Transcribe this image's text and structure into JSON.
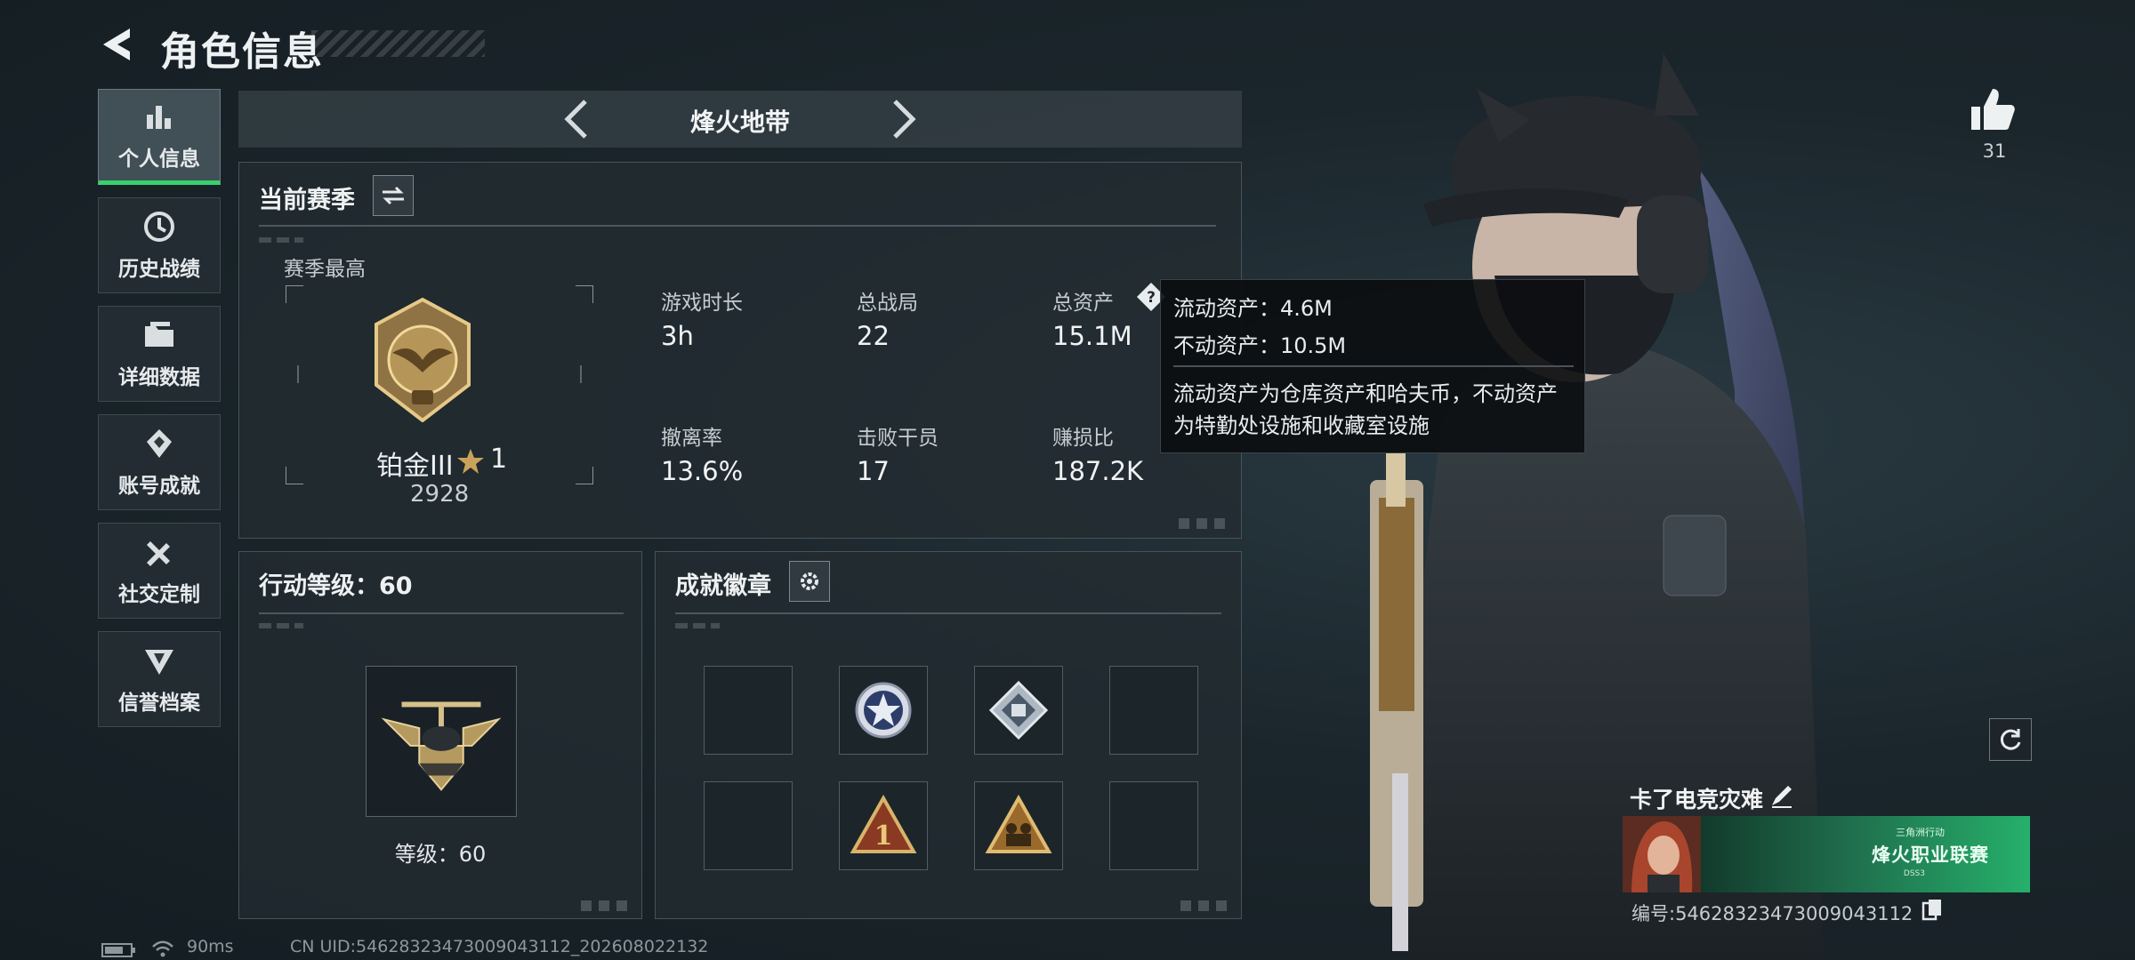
{
  "header": {
    "title": "角色信息"
  },
  "sidebar": {
    "items": [
      {
        "label": "个人信息",
        "active": true,
        "icon": "bar-chart-icon"
      },
      {
        "label": "历史战绩",
        "active": false,
        "icon": "clock-history-icon"
      },
      {
        "label": "详细数据",
        "active": false,
        "icon": "folder-icon"
      },
      {
        "label": "账号成就",
        "active": false,
        "icon": "achievement-icon"
      },
      {
        "label": "社交定制",
        "active": false,
        "icon": "tools-icon"
      },
      {
        "label": "信誉档案",
        "active": false,
        "icon": "shield-emblem-icon"
      }
    ]
  },
  "mode_nav": {
    "title": "烽火地带"
  },
  "season": {
    "title": "当前赛季",
    "best_label": "赛季最高",
    "rank": {
      "name": "铂金III",
      "stars": "1",
      "score": "2928"
    },
    "stats": [
      {
        "label": "游戏时长",
        "value": "3h"
      },
      {
        "label": "总战局",
        "value": "22"
      },
      {
        "label": "总资产",
        "value": "15.1M"
      },
      {
        "label": "撤离率",
        "value": "13.6%"
      },
      {
        "label": "击败干员",
        "value": "17"
      },
      {
        "label": "赚损比",
        "value": "187.2K"
      }
    ]
  },
  "tooltip": {
    "line1": "流动资产：4.6M",
    "line2": "不动资产：10.5M",
    "desc1": "流动资产为仓库资产和哈夫币，不动资产",
    "desc2": "为特勤处设施和收藏室设施"
  },
  "action_level": {
    "title": "行动等级：60",
    "level_text": "等级：60"
  },
  "badges": {
    "title": "成就徽章",
    "slots": [
      "empty",
      "star-emblem-badge",
      "diamond-badge",
      "empty",
      "empty",
      "rank-1-badge",
      "squad-badge",
      "empty"
    ]
  },
  "profile": {
    "likes": "31",
    "name": "卡了电竞灾难",
    "banner_title": "烽火职业联赛",
    "banner_sub": "三角洲行动",
    "banner_tag": "DSS3",
    "player_id": "编号:5462832347300904311​2"
  },
  "status_bar": {
    "ping": "90ms",
    "uid": "CN UID:5462832347300904311​2_202608022132"
  },
  "colors": {
    "accent_green": "#38d16d",
    "panel_border": "#46535a",
    "gold": "#c9a35a"
  }
}
